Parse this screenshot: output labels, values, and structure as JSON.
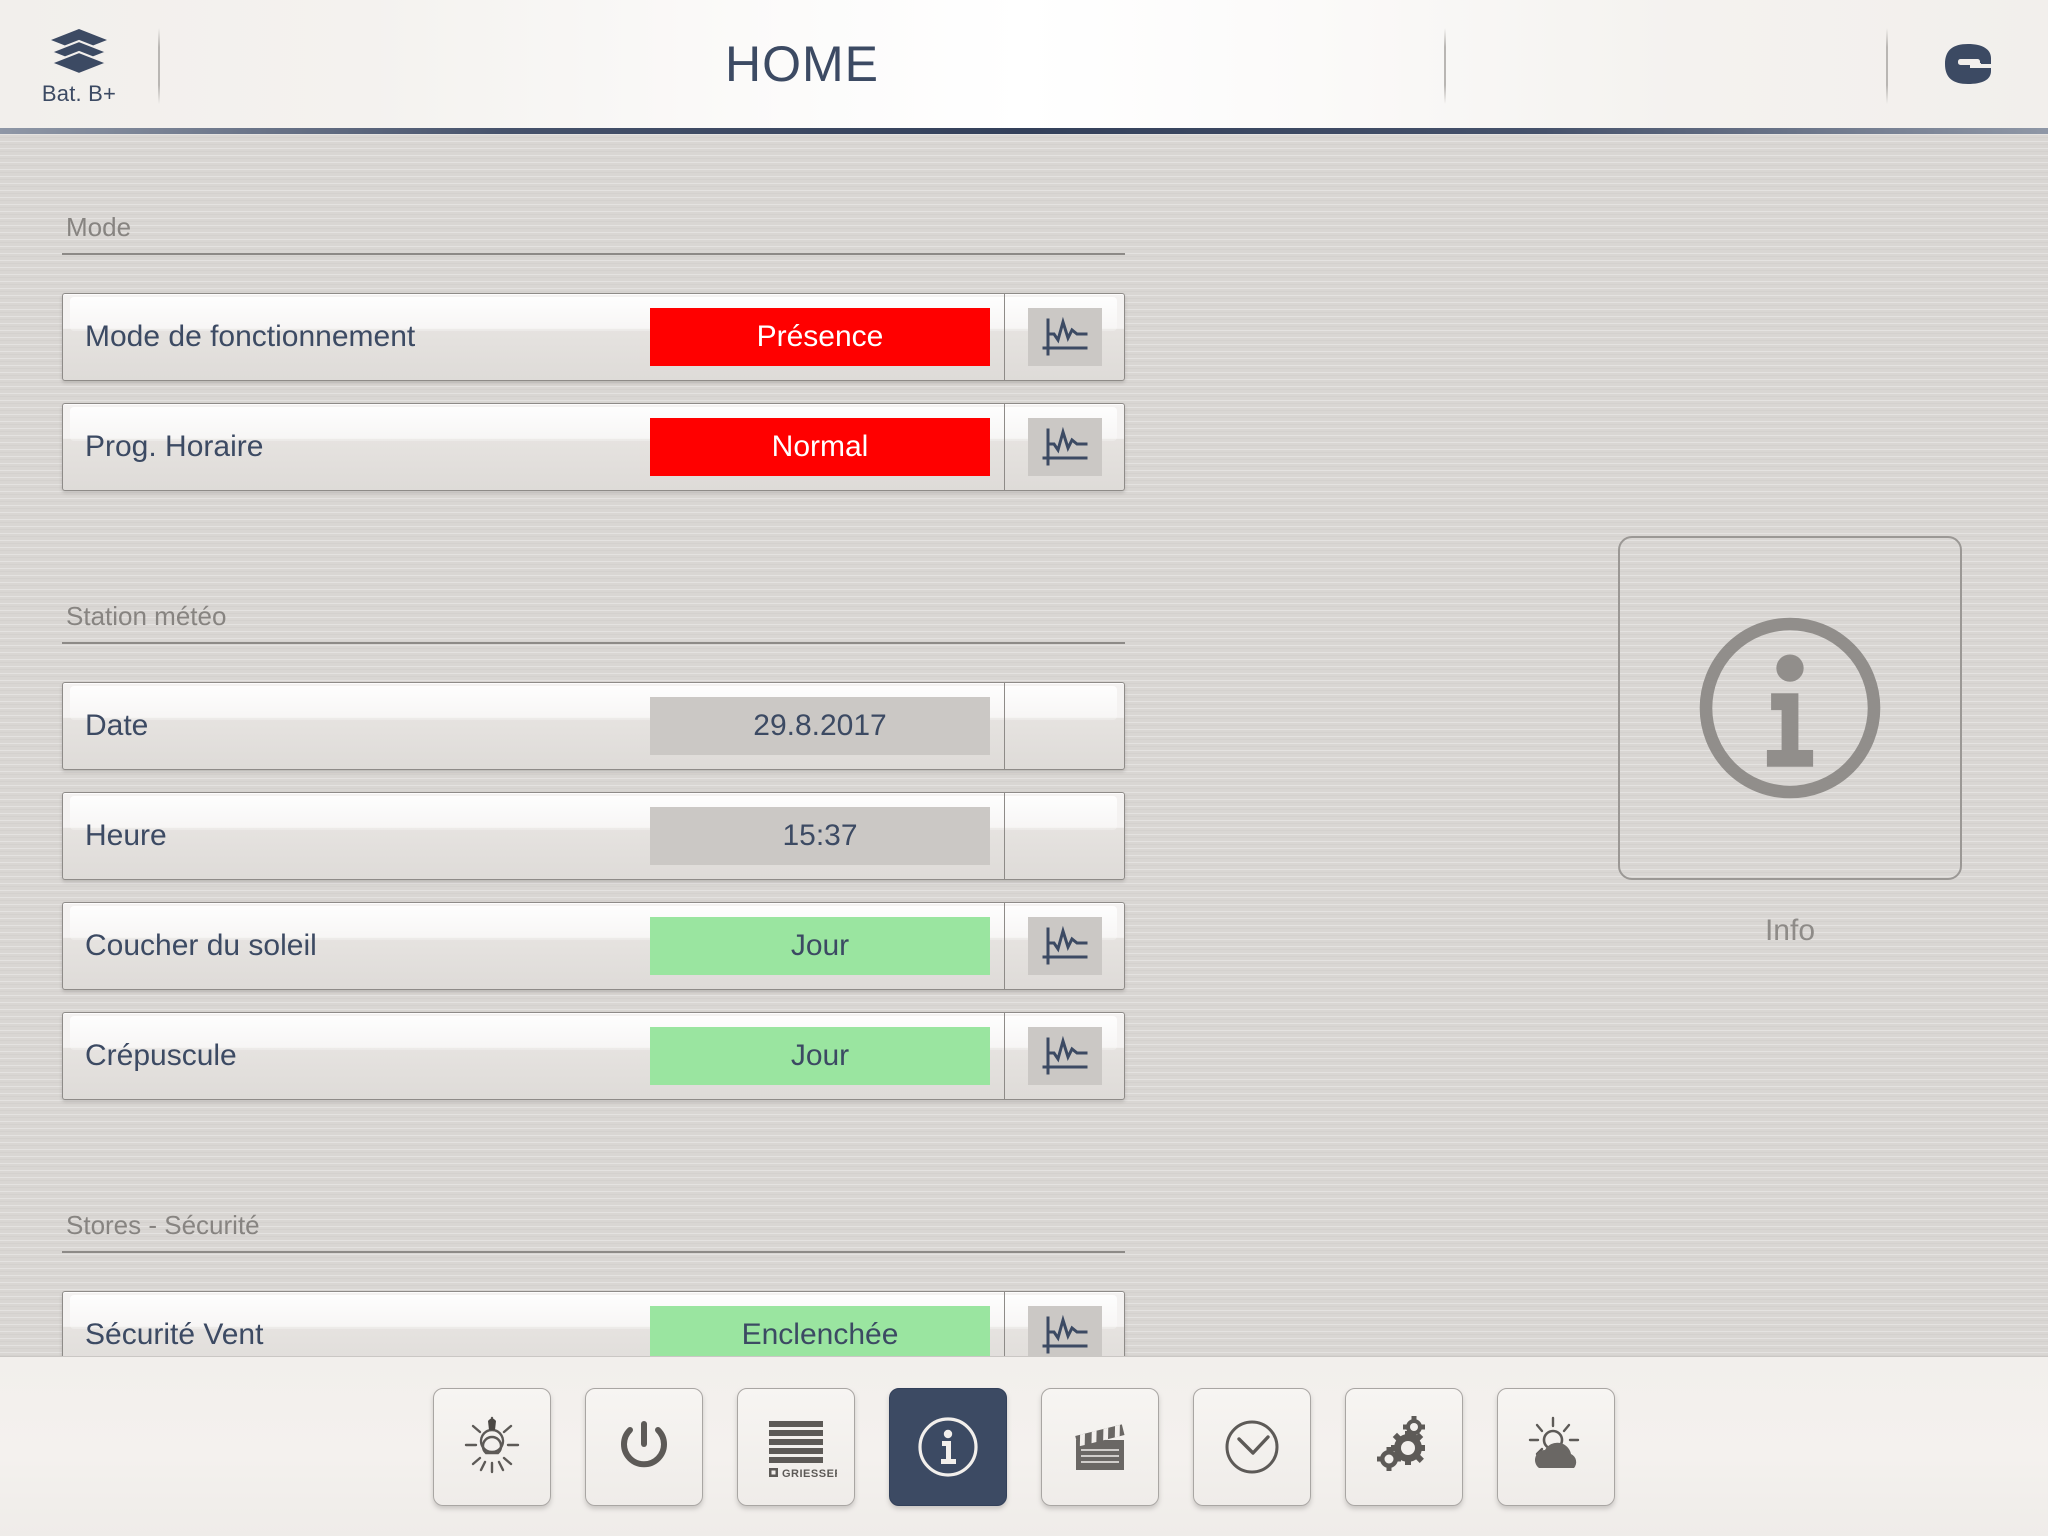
{
  "header": {
    "left_icon": "layers-icon",
    "left_label": "Bat. B+",
    "title": "HOME",
    "right_logo": "e-logo",
    "accent_color": "#3c4a63"
  },
  "sections": [
    {
      "title": "Mode",
      "rows": [
        {
          "label": "Mode de fonctionnement",
          "value": "Présence",
          "state": "red",
          "action_icon": "chart-icon",
          "has_action": true
        },
        {
          "label": "Prog. Horaire",
          "value": "Normal",
          "state": "red",
          "action_icon": "chart-icon",
          "has_action": true
        }
      ]
    },
    {
      "title": "Station météo",
      "rows": [
        {
          "label": "Date",
          "value": "29.8.2017",
          "state": "grey",
          "action_icon": "",
          "has_action": false
        },
        {
          "label": "Heure",
          "value": "15:37",
          "state": "grey",
          "action_icon": "",
          "has_action": false
        },
        {
          "label": "Coucher du soleil",
          "value": "Jour",
          "state": "green",
          "action_icon": "chart-icon",
          "has_action": true
        },
        {
          "label": "Crépuscule",
          "value": "Jour",
          "state": "green",
          "action_icon": "chart-icon",
          "has_action": true
        }
      ]
    },
    {
      "title": "Stores - Sécurité",
      "rows": [
        {
          "label": "Sécurité Vent",
          "value": "Enclenchée",
          "state": "green",
          "action_icon": "chart-icon",
          "has_action": true
        }
      ]
    }
  ],
  "info_panel": {
    "icon": "info-circle-icon",
    "caption": "Info"
  },
  "toolbar": {
    "items": [
      {
        "icon": "lightbulb-icon",
        "active": false
      },
      {
        "icon": "power-icon",
        "active": false
      },
      {
        "icon": "blinds-icon",
        "active": false,
        "brand": "GRIESSER"
      },
      {
        "icon": "info-circle-icon",
        "active": true
      },
      {
        "icon": "clapperboard-icon",
        "active": false
      },
      {
        "icon": "clock-icon",
        "active": false
      },
      {
        "icon": "gears-icon",
        "active": false
      },
      {
        "icon": "weather-sun-cloud-icon",
        "active": false
      }
    ]
  },
  "colors": {
    "accent_navy": "#3c4a63",
    "alarm_red": "#ff0000",
    "ok_green": "#9ae5a0",
    "neutral_grey": "#cbc8c5",
    "background": "#d9d6d3"
  }
}
